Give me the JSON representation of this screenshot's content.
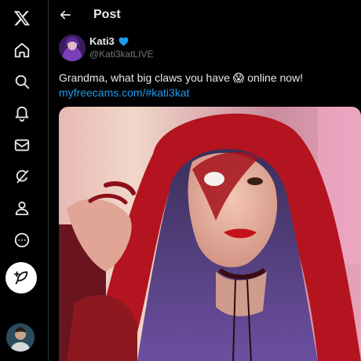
{
  "nav": {
    "items": [
      {
        "name": "x-logo-icon"
      },
      {
        "name": "home-icon"
      },
      {
        "name": "search-icon"
      },
      {
        "name": "notifications-icon"
      },
      {
        "name": "messages-icon"
      },
      {
        "name": "grok-icon"
      },
      {
        "name": "profile-icon"
      },
      {
        "name": "more-icon"
      }
    ],
    "compose_icon": "compose-feather-icon"
  },
  "header": {
    "title": "Post"
  },
  "tweet": {
    "author_name": "Kati3",
    "author_handle": "@Kati3katLIVE",
    "verified": true,
    "text": "Grandma, what big claws you have 😱 online now!",
    "link": "myfreecams.com/#kati3kat"
  },
  "colors": {
    "background": "#000000",
    "text": "#e7e9ea",
    "secondary_text": "#71767b",
    "link": "#1d9bf0",
    "verified": "#1d9bf0",
    "divider": "#2f3336"
  }
}
